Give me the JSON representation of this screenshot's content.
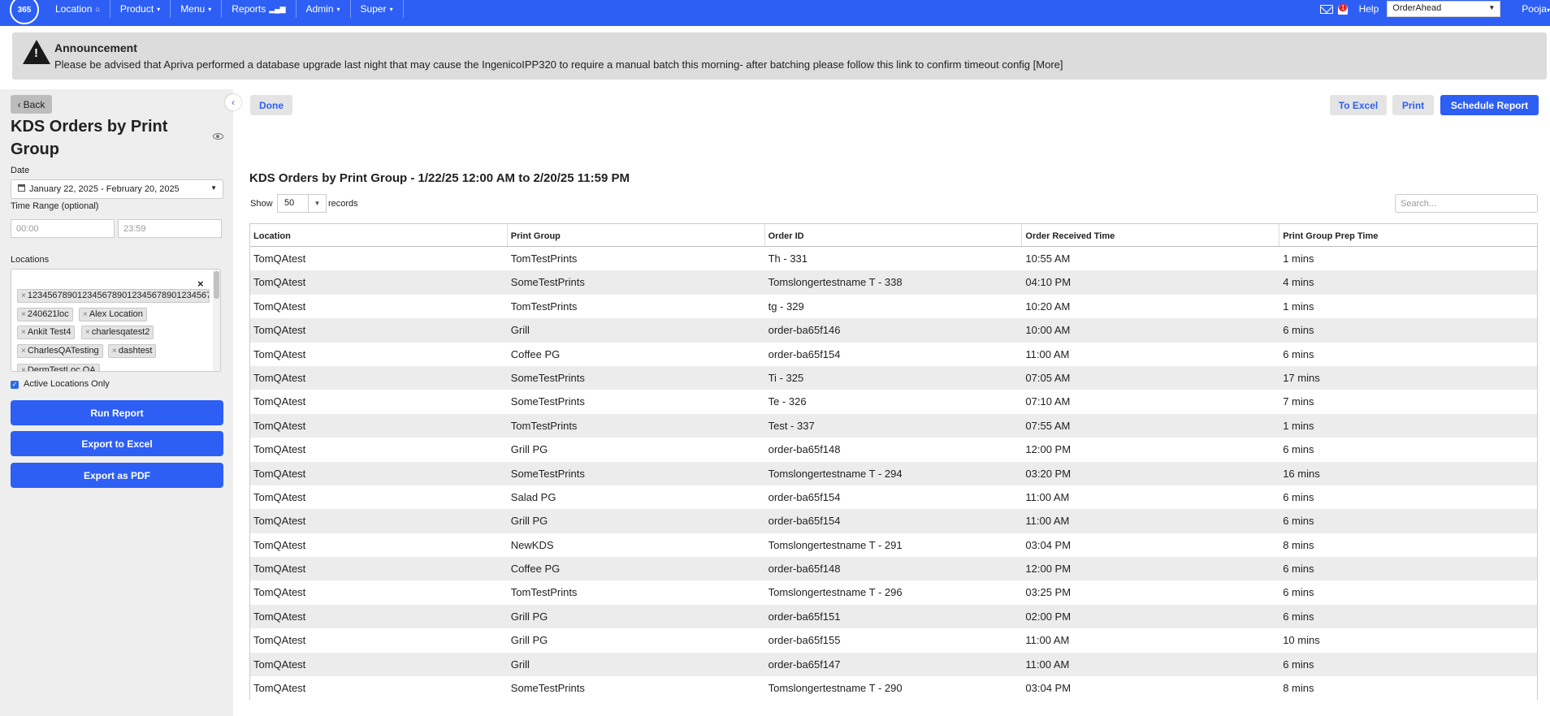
{
  "nav": {
    "logo": "365",
    "items": [
      {
        "label": "Location",
        "icon": "home-icon",
        "icon_glyph": "⌂"
      },
      {
        "label": "Product",
        "caret": "▾"
      },
      {
        "label": "Menu",
        "caret": "▾"
      },
      {
        "label": "Reports",
        "icon": "bar-chart-icon",
        "icon_glyph": "▂▄▆"
      },
      {
        "label": "Admin",
        "caret": "▾"
      },
      {
        "label": "Super",
        "caret": "▾"
      }
    ],
    "notification_count": "1",
    "help": "Help",
    "org_select": "OrderAhead",
    "user": "Pooja",
    "accent_color": "#2d5ff5"
  },
  "announcement": {
    "title": "Announcement",
    "text": "Please be advised that Apriva performed a database upgrade last night that may cause the IngenicoIPP320 to require a manual batch this morning- after batching please follow this link to confirm timeout config [More]"
  },
  "sidebar": {
    "back_label": "Back",
    "title": "KDS Orders by Print Group",
    "date_label": "Date",
    "date_value": "January 22, 2025 - February 20, 2025",
    "time_range_label": "Time Range (optional)",
    "time_start_placeholder": "00:00",
    "time_end_placeholder": "23:59",
    "locations_label": "Locations",
    "locations": [
      "1234567890123456789012345678901234567",
      "240621loc",
      "Alex Location",
      "Ankit Test4",
      "charlesqatest2",
      "CharlesQATesting",
      "dashtest",
      "DermTestLoc QA"
    ],
    "active_only_label": "Active Locations Only",
    "active_only_checked": true,
    "run_report": "Run Report",
    "export_excel": "Export to Excel",
    "export_pdf": "Export as PDF"
  },
  "toolbar": {
    "done": "Done",
    "to_excel": "To Excel",
    "print": "Print",
    "schedule": "Schedule Report"
  },
  "report": {
    "title": "KDS Orders by Print Group - 1/22/25 12:00 AM to 2/20/25 11:59 PM",
    "show_label": "Show",
    "page_size": "50",
    "records_label": "records",
    "search_placeholder": "Search...",
    "columns": [
      "Location",
      "Print Group",
      "Order ID",
      "Order Received Time",
      "Print Group Prep Time"
    ],
    "rows": [
      [
        "TomQAtest",
        "TomTestPrints",
        "Th - 331",
        "10:55 AM",
        "1 mins"
      ],
      [
        "TomQAtest",
        "SomeTestPrints",
        "Tomslongertestname T - 338",
        "04:10 PM",
        "4 mins"
      ],
      [
        "TomQAtest",
        "TomTestPrints",
        "tg - 329",
        "10:20 AM",
        "1 mins"
      ],
      [
        "TomQAtest",
        "Grill",
        "order-ba65f146",
        "10:00 AM",
        "6 mins"
      ],
      [
        "TomQAtest",
        "Coffee PG",
        "order-ba65f154",
        "11:00 AM",
        "6 mins"
      ],
      [
        "TomQAtest",
        "SomeTestPrints",
        "Ti - 325",
        "07:05 AM",
        "17 mins"
      ],
      [
        "TomQAtest",
        "SomeTestPrints",
        "Te - 326",
        "07:10 AM",
        "7 mins"
      ],
      [
        "TomQAtest",
        "TomTestPrints",
        "Test - 337",
        "07:55 AM",
        "1 mins"
      ],
      [
        "TomQAtest",
        "Grill PG",
        "order-ba65f148",
        "12:00 PM",
        "6 mins"
      ],
      [
        "TomQAtest",
        "SomeTestPrints",
        "Tomslongertestname T - 294",
        "03:20 PM",
        "16 mins"
      ],
      [
        "TomQAtest",
        "Salad PG",
        "order-ba65f154",
        "11:00 AM",
        "6 mins"
      ],
      [
        "TomQAtest",
        "Grill PG",
        "order-ba65f154",
        "11:00 AM",
        "6 mins"
      ],
      [
        "TomQAtest",
        "NewKDS",
        "Tomslongertestname T - 291",
        "03:04 PM",
        "8 mins"
      ],
      [
        "TomQAtest",
        "Coffee PG",
        "order-ba65f148",
        "12:00 PM",
        "6 mins"
      ],
      [
        "TomQAtest",
        "TomTestPrints",
        "Tomslongertestname T - 296",
        "03:25 PM",
        "6 mins"
      ],
      [
        "TomQAtest",
        "Grill PG",
        "order-ba65f151",
        "02:00 PM",
        "6 mins"
      ],
      [
        "TomQAtest",
        "Grill PG",
        "order-ba65f155",
        "11:00 AM",
        "10 mins"
      ],
      [
        "TomQAtest",
        "Grill",
        "order-ba65f147",
        "11:00 AM",
        "6 mins"
      ],
      [
        "TomQAtest",
        "SomeTestPrints",
        "Tomslongertestname T - 290",
        "03:04 PM",
        "8 mins"
      ]
    ]
  }
}
